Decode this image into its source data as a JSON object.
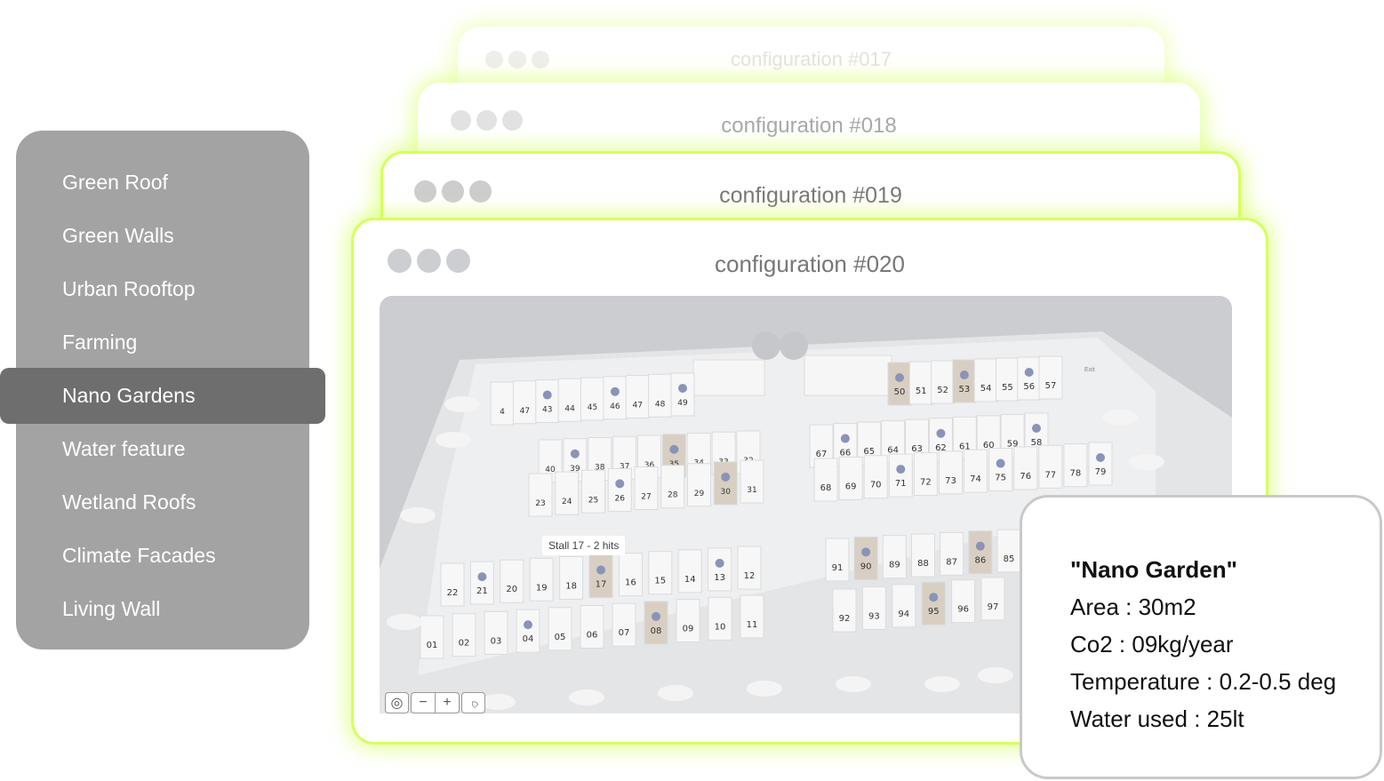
{
  "sidebar": {
    "items": [
      {
        "label": "Green Roof"
      },
      {
        "label": "Green Walls"
      },
      {
        "label": "Urban Rooftop"
      },
      {
        "label": "Farming"
      },
      {
        "label": "Nano Gardens",
        "selected": true
      },
      {
        "label": "Water feature"
      },
      {
        "label": "Wetland Roofs"
      },
      {
        "label": "Climate Facades"
      },
      {
        "label": "Living Wall"
      }
    ]
  },
  "windows": [
    {
      "title": "configuration #017"
    },
    {
      "title": "configuration #018"
    },
    {
      "title": "configuration #019"
    },
    {
      "title": "configuration #020",
      "active": true
    }
  ],
  "map": {
    "tooltip": "Stall 17 - 2 hits",
    "exit_label": "Exit",
    "rows": [
      [
        "4",
        "47",
        "43",
        "44",
        "45",
        "46",
        "47",
        "48",
        "49"
      ],
      [
        "40",
        "39",
        "38",
        "37",
        "36",
        "35",
        "34",
        "33",
        "32"
      ],
      [
        "23",
        "24",
        "25",
        "26",
        "27",
        "28",
        "29",
        "30",
        "31"
      ],
      [
        "22",
        "21",
        "20",
        "19",
        "18",
        "17",
        "16",
        "15",
        "14",
        "13",
        "12"
      ],
      [
        "01",
        "02",
        "03",
        "04",
        "05",
        "06",
        "07",
        "08",
        "09",
        "10",
        "11"
      ],
      [
        "50",
        "51",
        "52",
        "53",
        "54",
        "55",
        "56",
        "57"
      ],
      [
        "67",
        "66",
        "65",
        "64",
        "63",
        "62",
        "61",
        "60",
        "59",
        "58"
      ],
      [
        "68",
        "69",
        "70",
        "71",
        "72",
        "73",
        "74",
        "75",
        "76",
        "77",
        "78",
        "79"
      ],
      [
        "91",
        "90",
        "89",
        "88",
        "87",
        "86",
        "85"
      ],
      [
        "92",
        "93",
        "94",
        "95",
        "96",
        "97"
      ]
    ],
    "hits": [
      "43",
      "46",
      "49",
      "39",
      "26",
      "35",
      "30",
      "21",
      "17",
      "13",
      "04",
      "08",
      "50",
      "53",
      "56",
      "66",
      "62",
      "58",
      "71",
      "75",
      "79",
      "90",
      "86",
      "95"
    ],
    "highlighted": [
      "35",
      "30",
      "17",
      "08",
      "50",
      "53",
      "90",
      "86",
      "95"
    ],
    "controls": [
      {
        "icon": "locate-icon",
        "glyph": "◎"
      },
      {
        "icon": "zoom-out-icon",
        "glyph": "−"
      },
      {
        "icon": "zoom-in-icon",
        "glyph": "+"
      },
      {
        "icon": "tag-icon",
        "glyph": "⌂"
      }
    ],
    "colors": {
      "hit": "#8a93b8",
      "highlight": "#d8cfc2",
      "accent": "#d6ff5c"
    }
  },
  "info": {
    "name": "\"Nano Garden\"",
    "area": "Area : 30m2",
    "co2": "Co2 :  09kg/year",
    "temperature": "Temperature : 0.2-0.5 deg",
    "water": "Water used : 25lt"
  }
}
